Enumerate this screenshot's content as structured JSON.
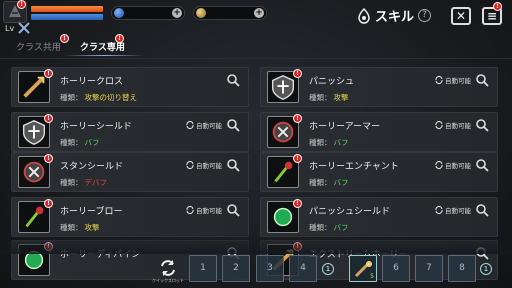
{
  "header": {
    "level_label": "Lv",
    "title": "スキル",
    "help_symbol": "?",
    "close_symbol": "✕",
    "menu_symbol": "≡",
    "currencies": [
      {
        "icon": "blue-orb-icon",
        "color": "#3d7bd8"
      },
      {
        "icon": "gold-coin-icon",
        "color": "#c9a04a"
      }
    ],
    "badge": "!"
  },
  "tabs": [
    {
      "label": "クラス共用",
      "active": false
    },
    {
      "label": "クラス専用",
      "active": true
    }
  ],
  "common": {
    "type_prefix": "種類：",
    "auto_label": "自動可能"
  },
  "skills_left": [
    {
      "name": "ホーリークロス",
      "type": "攻撃の切り替え",
      "type_color": "#e8d24a",
      "auto": false,
      "icon": "holy-cross-sword-icon"
    },
    {
      "name": "ホーリーシールド",
      "type": "バフ",
      "type_color": "#58d368",
      "auto": true,
      "icon": "holy-shield-icon"
    },
    {
      "name": "スタンシールド",
      "type": "デバフ",
      "type_color": "#e0483c",
      "auto": true,
      "icon": "stun-shield-icon"
    },
    {
      "name": "ホーリーブロー",
      "type": "攻撃",
      "type_color": "#e8d24a",
      "auto": true,
      "icon": "holy-blow-icon"
    },
    {
      "name": "ホーリーディバイン",
      "type": "",
      "type_color": "#e8d24a",
      "auto": false,
      "icon": "holy-divine-icon"
    }
  ],
  "skills_right": [
    {
      "name": "パニッシュ",
      "type": "攻撃",
      "type_color": "#e8d24a",
      "auto": true,
      "icon": "punish-icon"
    },
    {
      "name": "ホーリーアーマー",
      "type": "バフ",
      "type_color": "#58d368",
      "auto": true,
      "icon": "holy-armor-icon"
    },
    {
      "name": "ホーリーエンチャント",
      "type": "バフ",
      "type_color": "#58d368",
      "auto": true,
      "icon": "holy-enchant-icon"
    },
    {
      "name": "パニッシュシールド",
      "type": "バフ",
      "type_color": "#58d368",
      "auto": true,
      "icon": "punish-shield-icon"
    },
    {
      "name": "エクストリームホーリー",
      "type": "",
      "type_color": "#58d368",
      "auto": false,
      "icon": "extreme-holy-icon"
    }
  ],
  "bottom": {
    "quick_slot_label": "クイックスロット",
    "slots": [
      "1",
      "2",
      "3",
      "4",
      "",
      "6",
      "7",
      "8"
    ],
    "filled_slot_count": "5",
    "page_markers": [
      "1",
      "1"
    ]
  }
}
